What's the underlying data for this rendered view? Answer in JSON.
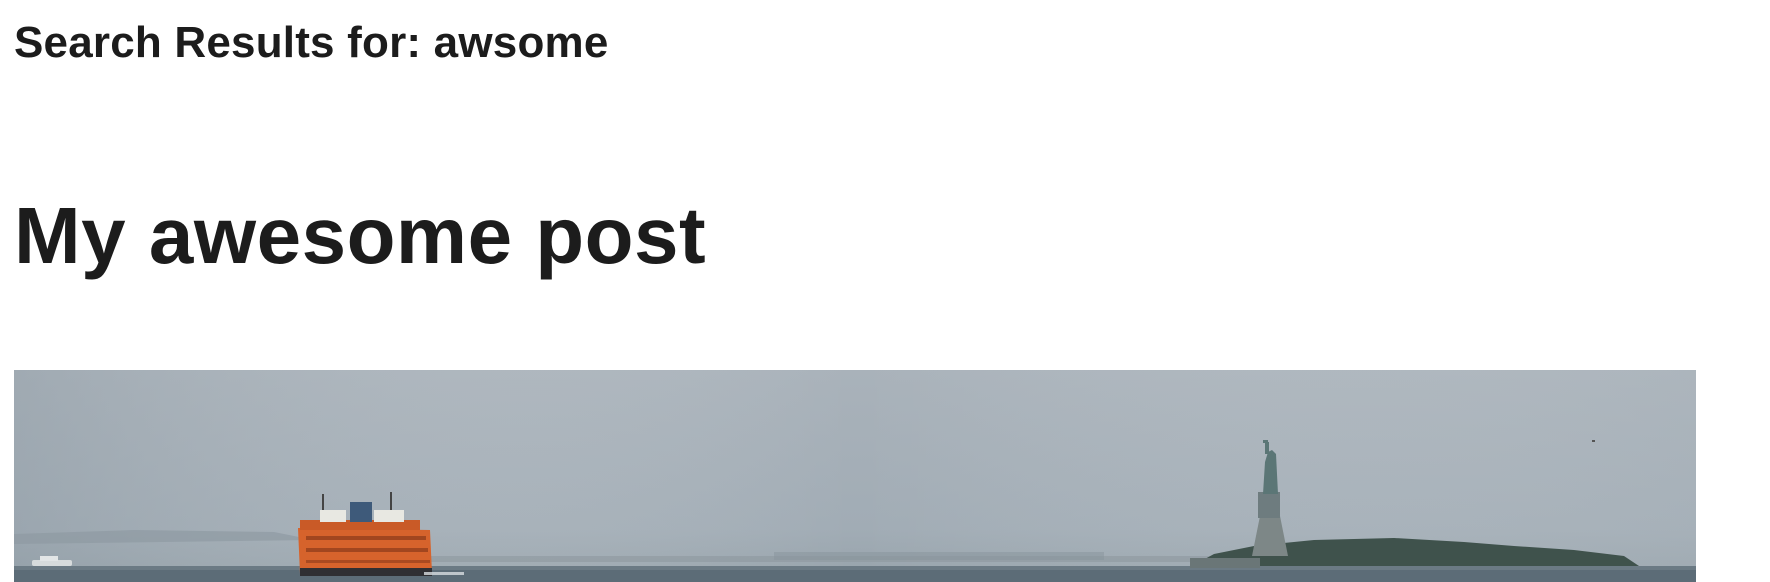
{
  "search": {
    "heading": "Search Results for: awsome"
  },
  "results": [
    {
      "title": "My awesome post",
      "image": {
        "subject": "harbor-ferry-statue-photo"
      }
    }
  ],
  "colors": {
    "text": "#1c1c1c",
    "sky_top": "#a9b3bb",
    "sky_bottom": "#9ea9b2",
    "water": "#5f6f7a",
    "ferry": "#d9662e",
    "island": "#3e4f4a"
  }
}
